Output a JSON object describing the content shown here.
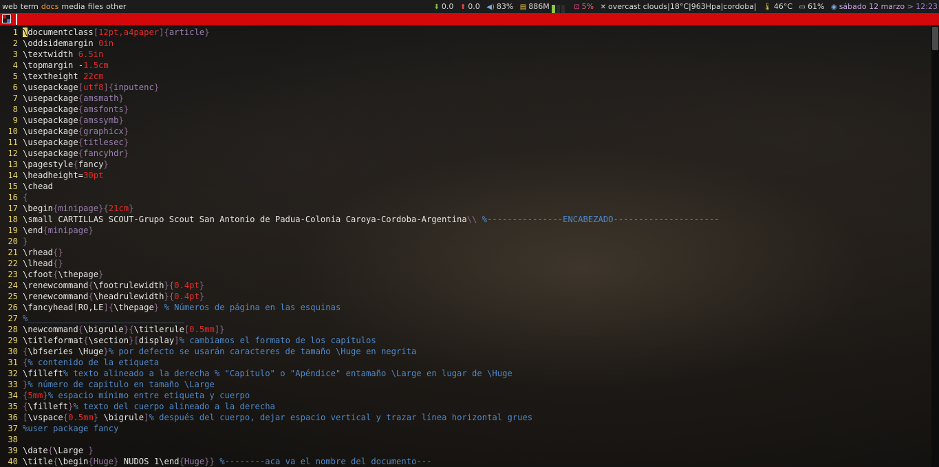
{
  "topbar": {
    "tags": [
      {
        "label": "web",
        "active": false
      },
      {
        "label": "term",
        "active": false
      },
      {
        "label": "docs",
        "active": true
      },
      {
        "label": "media",
        "active": false
      },
      {
        "label": "files",
        "active": false
      },
      {
        "label": "other",
        "active": false
      }
    ],
    "net_down": "0.0",
    "net_up": "0.0",
    "volume": "83%",
    "memory": "886M",
    "cpu": "5%",
    "weather": "overcast clouds|18°C|963Hpa|cordoba|",
    "temperature": "46°C",
    "battery": "61%",
    "date": "sábado 12 marzo",
    "separator": ">",
    "time": "12:23"
  },
  "icons": {
    "net_down": "arrow-down-icon",
    "net_up": "arrow-up-icon",
    "volume": "speaker-icon",
    "memory": "memory-icon",
    "cpu": "cpu-icon",
    "temperature": "thermometer-icon",
    "battery": "battery-icon",
    "clock": "clock-icon"
  },
  "colors": {
    "active_tag": "#ff9a2f",
    "titlebar": "#d4070a",
    "line_number": "#e8d46a",
    "comment": "#4e88c8",
    "number": "#e22a2a",
    "argument": "#9a7fb0"
  },
  "editor": {
    "lines": [
      {
        "n": "1",
        "parts": [
          [
            "cursor",
            "\\"
          ],
          [
            "c",
            "documentclass"
          ],
          [
            "br",
            "["
          ],
          [
            "num",
            "12pt,a4paper"
          ],
          [
            "br",
            "]{"
          ],
          [
            "arg",
            "article"
          ],
          [
            "br",
            "}"
          ]
        ]
      },
      {
        "n": "2",
        "parts": [
          [
            "c",
            "\\oddsidemargin "
          ],
          [
            "num",
            "0in"
          ]
        ]
      },
      {
        "n": "3",
        "parts": [
          [
            "c",
            "\\textwidth "
          ],
          [
            "num",
            "6.5in"
          ]
        ]
      },
      {
        "n": "4",
        "parts": [
          [
            "c",
            "\\topmargin -"
          ],
          [
            "num",
            "1.5cm"
          ]
        ]
      },
      {
        "n": "5",
        "parts": [
          [
            "c",
            "\\textheight "
          ],
          [
            "num",
            "22cm"
          ]
        ]
      },
      {
        "n": "6",
        "parts": [
          [
            "c",
            "\\usepackage"
          ],
          [
            "br",
            "["
          ],
          [
            "num",
            "utf8"
          ],
          [
            "br",
            "]{"
          ],
          [
            "arg",
            "inputenc"
          ],
          [
            "br",
            "}"
          ]
        ]
      },
      {
        "n": "7",
        "parts": [
          [
            "c",
            "\\usepackage"
          ],
          [
            "br",
            "{"
          ],
          [
            "arg",
            "amsmath"
          ],
          [
            "br",
            "}"
          ]
        ]
      },
      {
        "n": "8",
        "parts": [
          [
            "c",
            "\\usepackage"
          ],
          [
            "br",
            "{"
          ],
          [
            "arg",
            "amsfonts"
          ],
          [
            "br",
            "}"
          ]
        ]
      },
      {
        "n": "9",
        "parts": [
          [
            "c",
            "\\usepackage"
          ],
          [
            "br",
            "{"
          ],
          [
            "arg",
            "amssymb"
          ],
          [
            "br",
            "}"
          ]
        ]
      },
      {
        "n": "10",
        "parts": [
          [
            "c",
            "\\usepackage"
          ],
          [
            "br",
            "{"
          ],
          [
            "arg",
            "graphicx"
          ],
          [
            "br",
            "}"
          ]
        ]
      },
      {
        "n": "11",
        "parts": [
          [
            "c",
            "\\usepackage"
          ],
          [
            "br",
            "{"
          ],
          [
            "arg",
            "titlesec"
          ],
          [
            "br",
            "}"
          ]
        ]
      },
      {
        "n": "12",
        "parts": [
          [
            "c",
            "\\usepackage"
          ],
          [
            "br",
            "{"
          ],
          [
            "arg",
            "fancyhdr"
          ],
          [
            "br",
            "}"
          ]
        ]
      },
      {
        "n": "13",
        "parts": [
          [
            "c",
            "\\pagestyle"
          ],
          [
            "br",
            "{"
          ],
          [
            "c",
            "fancy"
          ],
          [
            "br",
            "}"
          ]
        ]
      },
      {
        "n": "14",
        "parts": [
          [
            "c",
            "\\headheight="
          ],
          [
            "num",
            "30pt"
          ]
        ]
      },
      {
        "n": "15",
        "parts": [
          [
            "c",
            "\\chead"
          ]
        ]
      },
      {
        "n": "16",
        "parts": [
          [
            "br",
            "{"
          ]
        ]
      },
      {
        "n": "17",
        "parts": [
          [
            "c",
            "\\begin"
          ],
          [
            "br",
            "{"
          ],
          [
            "arg",
            "minipage"
          ],
          [
            "br",
            "}{"
          ],
          [
            "num",
            "21cm"
          ],
          [
            "br",
            "}"
          ]
        ]
      },
      {
        "n": "18",
        "parts": [
          [
            "c",
            "\\small CARTILLAS SCOUT-Grupo Scout San Antonio de Padua-Colonia Caroya-Cordoba-Argentina"
          ],
          [
            "br",
            "\\\\ "
          ],
          [
            "cm",
            "%---------------ENCABEZADO---------------------"
          ]
        ]
      },
      {
        "n": "19",
        "parts": [
          [
            "c",
            "\\end"
          ],
          [
            "br",
            "{"
          ],
          [
            "arg",
            "minipage"
          ],
          [
            "br",
            "}"
          ]
        ]
      },
      {
        "n": "20",
        "parts": [
          [
            "br",
            "}"
          ]
        ]
      },
      {
        "n": "21",
        "parts": [
          [
            "c",
            "\\rhead"
          ],
          [
            "br",
            "{}"
          ]
        ]
      },
      {
        "n": "22",
        "parts": [
          [
            "c",
            "\\lhead"
          ],
          [
            "br",
            "{}"
          ]
        ]
      },
      {
        "n": "23",
        "parts": [
          [
            "c",
            "\\cfoot"
          ],
          [
            "br",
            "{"
          ],
          [
            "c",
            "\\thepage"
          ],
          [
            "br",
            "}"
          ]
        ]
      },
      {
        "n": "24",
        "parts": [
          [
            "c",
            "\\renewcommand"
          ],
          [
            "br",
            "{"
          ],
          [
            "c",
            "\\footrulewidth"
          ],
          [
            "br",
            "}{"
          ],
          [
            "num",
            "0.4pt"
          ],
          [
            "br",
            "}"
          ]
        ]
      },
      {
        "n": "25",
        "parts": [
          [
            "c",
            "\\renewcommand"
          ],
          [
            "br",
            "{"
          ],
          [
            "c",
            "\\headrulewidth"
          ],
          [
            "br",
            "}{"
          ],
          [
            "num",
            "0.4pt"
          ],
          [
            "br",
            "}"
          ]
        ]
      },
      {
        "n": "26",
        "parts": [
          [
            "c",
            "\\fancyhead"
          ],
          [
            "br",
            "["
          ],
          [
            "c",
            "RO,LE"
          ],
          [
            "br",
            "]{"
          ],
          [
            "c",
            "\\thepage"
          ],
          [
            "br",
            "} "
          ],
          [
            "cm",
            "% Números de página en las esquinas"
          ]
        ]
      },
      {
        "n": "27",
        "parts": [
          [
            "cm",
            "%_______________________________"
          ]
        ]
      },
      {
        "n": "28",
        "parts": [
          [
            "c",
            "\\newcommand"
          ],
          [
            "br",
            "{"
          ],
          [
            "c",
            "\\bigrule"
          ],
          [
            "br",
            "}{"
          ],
          [
            "c",
            "\\titlerule"
          ],
          [
            "br",
            "["
          ],
          [
            "num",
            "0.5mm"
          ],
          [
            "br",
            "]}"
          ]
        ]
      },
      {
        "n": "29",
        "parts": [
          [
            "c",
            "\\titleformat"
          ],
          [
            "br",
            "{"
          ],
          [
            "c",
            "\\section"
          ],
          [
            "br",
            "}["
          ],
          [
            "c",
            "display"
          ],
          [
            "br",
            "]"
          ],
          [
            "cm",
            "% cambiamos el formato de los capítulos"
          ]
        ]
      },
      {
        "n": "30",
        "parts": [
          [
            "br",
            "{"
          ],
          [
            "c",
            "\\bfseries \\Huge"
          ],
          [
            "br",
            "}"
          ],
          [
            "cm",
            "% por defecto se usarán caracteres de tamaño \\Huge en negrita"
          ]
        ]
      },
      {
        "n": "31",
        "parts": [
          [
            "br",
            "{"
          ],
          [
            "cm",
            "% contenido de la etiqueta"
          ]
        ]
      },
      {
        "n": "32",
        "parts": [
          [
            "c",
            "\\filleft"
          ],
          [
            "cm",
            "% texto alineado a la derecha % \"Capítulo\" o \"Apéndice\" entamaño \\Large en lugar de \\Huge"
          ]
        ]
      },
      {
        "n": "33",
        "parts": [
          [
            "br",
            "}"
          ],
          [
            "cm",
            "% número de capitulo en tamaño \\Large"
          ]
        ]
      },
      {
        "n": "34",
        "parts": [
          [
            "br",
            "{"
          ],
          [
            "num",
            "5mm"
          ],
          [
            "br",
            "}"
          ],
          [
            "cm",
            "% espacio mínimo entre etiqueta y cuerpo"
          ]
        ]
      },
      {
        "n": "35",
        "parts": [
          [
            "br",
            "{"
          ],
          [
            "c",
            "\\filleft"
          ],
          [
            "br",
            "}"
          ],
          [
            "cm",
            "% texto del cuerpo alineado a la derecha"
          ]
        ]
      },
      {
        "n": "36",
        "parts": [
          [
            "br",
            "["
          ],
          [
            "c",
            "\\vspace"
          ],
          [
            "br",
            "{"
          ],
          [
            "num",
            "0.5mm"
          ],
          [
            "br",
            "} "
          ],
          [
            "c",
            "\\bigrule"
          ],
          [
            "br",
            "]"
          ],
          [
            "cm",
            "% después del cuerpo, dejar espacio vertical y trazar línea horizontal grues"
          ]
        ]
      },
      {
        "n": "37",
        "parts": [
          [
            "cm",
            "%user package fancy"
          ]
        ]
      },
      {
        "n": "38",
        "parts": []
      },
      {
        "n": "39",
        "parts": [
          [
            "c",
            "\\date"
          ],
          [
            "br",
            "{"
          ],
          [
            "c",
            "\\Large "
          ],
          [
            "br",
            "}"
          ]
        ]
      },
      {
        "n": "40",
        "parts": [
          [
            "c",
            "\\title"
          ],
          [
            "br",
            "{"
          ],
          [
            "c",
            "\\begin"
          ],
          [
            "br",
            "{"
          ],
          [
            "arg",
            "Huge"
          ],
          [
            "br",
            "} "
          ],
          [
            "c",
            "NUDOS 1"
          ],
          [
            "c",
            "\\end"
          ],
          [
            "br",
            "{"
          ],
          [
            "arg",
            "Huge"
          ],
          [
            "br",
            "}} "
          ],
          [
            "cm",
            "%--------aca va el nombre del documento---"
          ]
        ]
      }
    ]
  }
}
